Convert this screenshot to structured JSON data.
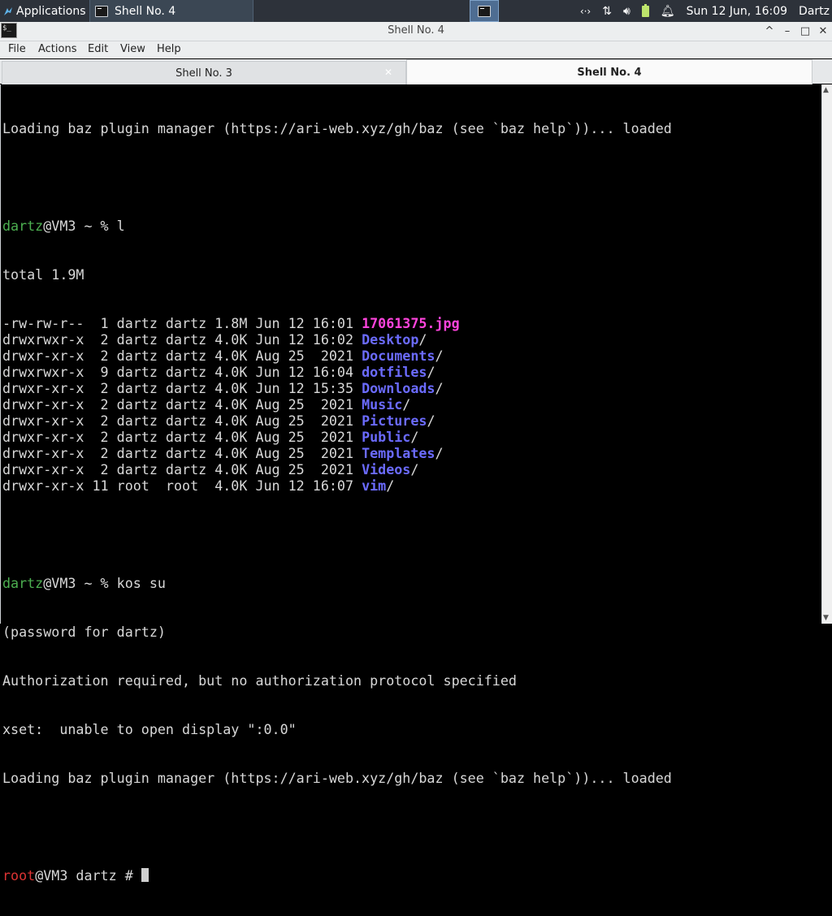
{
  "panel": {
    "apps_label": "Applications",
    "task_label": "Shell No. 4",
    "clock": "Sun 12 Jun, 16:09",
    "user": "Dartz",
    "tray_icons": [
      "network-arrows-icon",
      "transfer-icon",
      "volume-icon",
      "battery-icon",
      "notification-bell-icon"
    ]
  },
  "window": {
    "title": "Shell No. 4",
    "controls": [
      "^",
      "–",
      "□",
      "✕"
    ]
  },
  "menu": {
    "file": "File",
    "actions": "Actions",
    "edit": "Edit",
    "view": "View",
    "help": "Help"
  },
  "tabs": [
    {
      "label": "Shell No. 3",
      "active": false
    },
    {
      "label": "Shell No. 4",
      "active": true
    }
  ],
  "terminal": {
    "loading_line": "Loading baz plugin manager (https://ari-web.xyz/gh/baz (see `baz help`))... loaded",
    "prompt1_user": "dartz",
    "prompt1_rest": "@VM3 ~ % l",
    "total": "total 1.9M",
    "listing": [
      {
        "meta": "-rw-rw-r--  1 dartz dartz 1.8M Jun 12 16:01 ",
        "name": "17061375.jpg",
        "suffix": "",
        "kind": "file"
      },
      {
        "meta": "drwxrwxr-x  2 dartz dartz 4.0K Jun 12 16:02 ",
        "name": "Desktop",
        "suffix": "/",
        "kind": "dir"
      },
      {
        "meta": "drwxr-xr-x  2 dartz dartz 4.0K Aug 25  2021 ",
        "name": "Documents",
        "suffix": "/",
        "kind": "dir"
      },
      {
        "meta": "drwxrwxr-x  9 dartz dartz 4.0K Jun 12 16:04 ",
        "name": "dotfiles",
        "suffix": "/",
        "kind": "dir"
      },
      {
        "meta": "drwxr-xr-x  2 dartz dartz 4.0K Jun 12 15:35 ",
        "name": "Downloads",
        "suffix": "/",
        "kind": "dir"
      },
      {
        "meta": "drwxr-xr-x  2 dartz dartz 4.0K Aug 25  2021 ",
        "name": "Music",
        "suffix": "/",
        "kind": "dir"
      },
      {
        "meta": "drwxr-xr-x  2 dartz dartz 4.0K Aug 25  2021 ",
        "name": "Pictures",
        "suffix": "/",
        "kind": "dir"
      },
      {
        "meta": "drwxr-xr-x  2 dartz dartz 4.0K Aug 25  2021 ",
        "name": "Public",
        "suffix": "/",
        "kind": "dir"
      },
      {
        "meta": "drwxr-xr-x  2 dartz dartz 4.0K Aug 25  2021 ",
        "name": "Templates",
        "suffix": "/",
        "kind": "dir"
      },
      {
        "meta": "drwxr-xr-x  2 dartz dartz 4.0K Aug 25  2021 ",
        "name": "Videos",
        "suffix": "/",
        "kind": "dir"
      },
      {
        "meta": "drwxr-xr-x 11 root  root  4.0K Jun 12 16:07 ",
        "name": "vim",
        "suffix": "/",
        "kind": "dir"
      }
    ],
    "prompt2_user": "dartz",
    "prompt2_rest": "@VM3 ~ % kos su",
    "password_line": "(password for dartz)",
    "auth_line": "Authorization required, but no authorization protocol specified",
    "xset_line": "xset:  unable to open display \":0.0\"",
    "loading_line2": "Loading baz plugin manager (https://ari-web.xyz/gh/baz (see `baz help`))... loaded",
    "root_user": "root",
    "root_rest": "@VM3 dartz # "
  },
  "colors": {
    "panel_bg": "#2d323a",
    "prompt_user": "#4caf50",
    "root_user": "#dd3333",
    "directory": "#6b6bff",
    "image_file": "#ff44dd"
  }
}
